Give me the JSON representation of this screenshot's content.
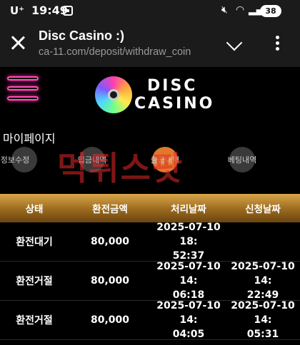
{
  "status_bar": {
    "carrier": "U⁺",
    "time": "19:49",
    "battery": "38"
  },
  "browser": {
    "title": "Disc Casino :)",
    "url": "ca-11.com/deposit/withdraw_coin"
  },
  "site": {
    "logo_line1": "DISC",
    "logo_line2": "CASINO",
    "section_title": "마이페이지",
    "tabs": [
      {
        "label": "정보수정",
        "active": false
      },
      {
        "label": "입금내역",
        "active": false
      },
      {
        "label": "출금내역",
        "active": true
      },
      {
        "label": "베팅내역",
        "active": false
      }
    ],
    "watermark": "먹튀스팟"
  },
  "table": {
    "headers": [
      "상태",
      "환전금액",
      "처리날짜",
      "신청날짜"
    ],
    "rows": [
      {
        "status": "환전대기",
        "amount": "80,000",
        "processed": "2025-07-10 18:\n52:37",
        "requested": ""
      },
      {
        "status": "환전거절",
        "amount": "80,000",
        "processed": "2025-07-10 14:\n06:18",
        "requested": "2025-07-10 14:\n22:49"
      },
      {
        "status": "환전거절",
        "amount": "80,000",
        "processed": "2025-07-10 14:\n04:05",
        "requested": "2025-07-10 14:\n05:31"
      }
    ]
  }
}
